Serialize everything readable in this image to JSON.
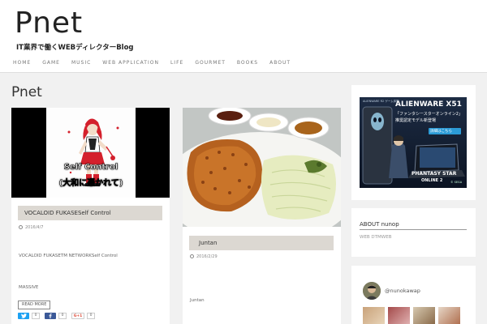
{
  "site": {
    "title": "Pnet",
    "tagline": "IT業界で働くWEBディレクターBlog"
  },
  "nav": {
    "items": [
      "HOME",
      "GAME",
      "MUSIC",
      "WEB APPLICATION",
      "LIFE",
      "GOURMET",
      "BOOKS",
      "ABOUT"
    ]
  },
  "main": {
    "page_title": "Pnet",
    "posts": [
      {
        "thumb_caption_1": "Self Control",
        "thumb_caption_2": "(大和に憑かれて)",
        "title": "VOCALOID FUKASESelf Control",
        "date": "2016/4/7",
        "excerpt_1": "VOCALOID FUKASETM NETWORKSelf Control",
        "excerpt_2": "MASSIVE",
        "read_more": "READ MORE",
        "share": {
          "twitter_icon": "twitter-bird-icon",
          "twitter_count": "0",
          "facebook_icon": "facebook-f-icon",
          "facebook_count": "0",
          "gplus_label": "G+1",
          "gplus_count": "0"
        }
      },
      {
        "title": "Juntan",
        "date": "2016/2/29",
        "excerpt_1": "Juntan"
      }
    ]
  },
  "sidebar": {
    "ad": {
      "brand_small": "ALIENWARE R2 ゲーム体験",
      "product": "ALIENWARE X51",
      "line_1": "「ファンタシースターオンライン2」",
      "line_2": "推奨認定モデル新登場",
      "cta": "詳細はこちら",
      "game_logo": "PHANTASY STAR",
      "game_logo_2": "ONLINE 2",
      "publisher": "© SEGA"
    },
    "about": {
      "heading": "ABOUT nunop",
      "text": "WEB  DTMWEB"
    },
    "instagram": {
      "handle": "@nunokawap"
    }
  },
  "colors": {
    "accent_bar": "#dcd8d2",
    "twitter": "#1da1f2",
    "facebook": "#3b5998",
    "gplus": "#dd4b39"
  }
}
